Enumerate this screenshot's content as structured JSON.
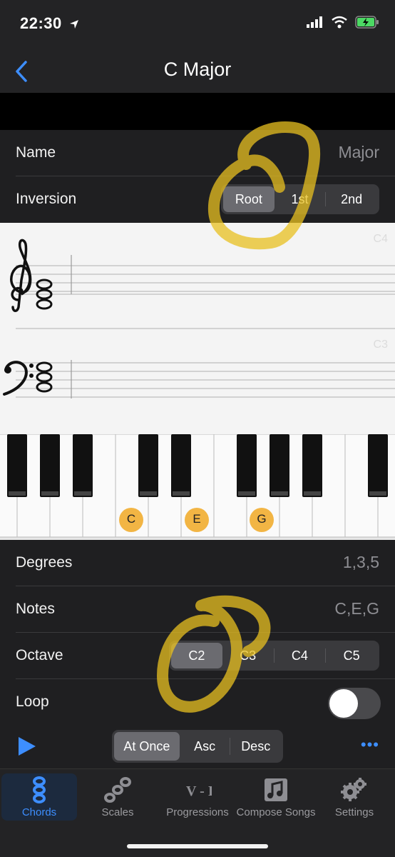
{
  "status": {
    "time": "22:30"
  },
  "nav": {
    "title": "C Major"
  },
  "rows": {
    "name_label": "Name",
    "name_value": "Major",
    "inversion_label": "Inversion",
    "inversion_options": [
      "Root",
      "1st",
      "2nd"
    ],
    "degrees_label": "Degrees",
    "degrees_value": "1,3,5",
    "notes_label": "Notes",
    "notes_value": "C,E,G",
    "octave_label": "Octave",
    "octave_options": [
      "C2",
      "C3",
      "C4",
      "C5"
    ],
    "loop_label": "Loop",
    "loop_on": false
  },
  "staff": {
    "treble_octave": "C4",
    "bass_octave": "C3"
  },
  "keyboard": {
    "highlighted_notes": [
      "C",
      "E",
      "G"
    ]
  },
  "toolbar": {
    "play_modes": [
      "At Once",
      "Asc",
      "Desc"
    ],
    "more_label": "•••"
  },
  "tabs": [
    {
      "label": "Chords",
      "icon": "chord-notes-icon"
    },
    {
      "label": "Scales",
      "icon": "scale-notes-icon"
    },
    {
      "label": "Progressions",
      "icon": "progression-icon"
    },
    {
      "label": "Compose Songs",
      "icon": "music-note-icon"
    },
    {
      "label": "Settings",
      "icon": "gear-icon"
    }
  ],
  "colors": {
    "accent": "#3d8eff",
    "note_badge": "#f2b544",
    "annotation": "#e8c020"
  }
}
